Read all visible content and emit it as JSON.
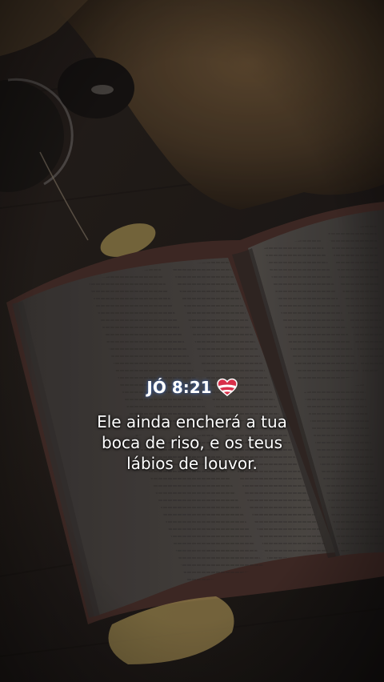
{
  "verse": {
    "reference": "JÓ 8:21",
    "emoji": "heart-icon",
    "lines": [
      "Ele ainda encherá a tua",
      "boca de riso, e os teus",
      "lábios de louvor."
    ]
  },
  "colors": {
    "text": "#ffffff",
    "glow": "#4a6eb4",
    "heart_red": "#d8304a",
    "heart_white": "#ffffff"
  }
}
